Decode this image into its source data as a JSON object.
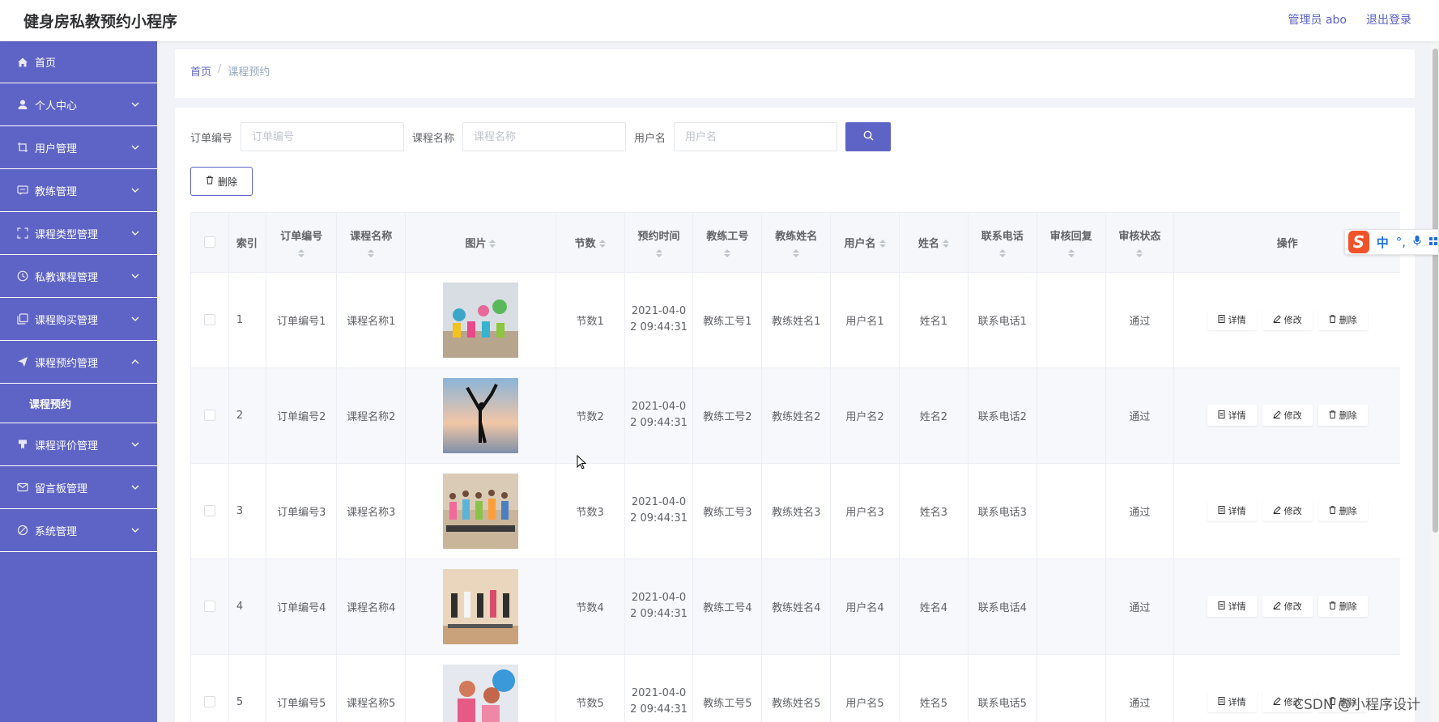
{
  "app": {
    "title": "健身房私教预约小程序"
  },
  "header": {
    "user": "管理员 abo",
    "logout": "退出登录"
  },
  "sidebar": {
    "items": [
      {
        "label": "首页",
        "icon": "home-icon"
      },
      {
        "label": "个人中心",
        "icon": "user-icon"
      },
      {
        "label": "用户管理",
        "icon": "crop-icon"
      },
      {
        "label": "教练管理",
        "icon": "chat-icon"
      },
      {
        "label": "课程类型管理",
        "icon": "fullscreen-icon"
      },
      {
        "label": "私教课程管理",
        "icon": "clock-icon"
      },
      {
        "label": "课程购买管理",
        "icon": "copy-icon"
      },
      {
        "label": "课程预约管理",
        "icon": "send-icon",
        "expanded": true,
        "sub": "课程预约"
      },
      {
        "label": "课程评价管理",
        "icon": "medal-icon"
      },
      {
        "label": "留言板管理",
        "icon": "message-icon"
      },
      {
        "label": "系统管理",
        "icon": "gear-icon"
      }
    ]
  },
  "breadcrumb": {
    "home": "首页",
    "sep": "/",
    "current": "课程预约"
  },
  "search": {
    "order_label": "订单编号",
    "order_placeholder": "订单编号",
    "course_label": "课程名称",
    "course_placeholder": "课程名称",
    "user_label": "用户名",
    "user_placeholder": "用户名"
  },
  "toolbar": {
    "delete_label": "删除"
  },
  "table": {
    "headers": {
      "index": "索引",
      "order_no": "订单编号",
      "course_name": "课程名称",
      "image": "图片",
      "sessions": "节数",
      "booking_time": "预约时间",
      "coach_id": "教练工号",
      "coach_name": "教练姓名",
      "username": "用户名",
      "name": "姓名",
      "phone": "联系电话",
      "review_reply": "审核回复",
      "review_status": "审核状态",
      "actions": "操作"
    },
    "actions": {
      "detail": "详情",
      "edit": "修改",
      "delete": "删除"
    },
    "rows": [
      {
        "index": "1",
        "order_no": "订单编号1",
        "course_name": "课程名称1",
        "sessions": "节数1",
        "time_a": "2021-04-0",
        "time_b": "2 09:44:31",
        "coach_id": "教练工号1",
        "coach_name": "教练姓名1",
        "username": "用户名1",
        "name": "姓名1",
        "phone": "联系电话1",
        "review_reply": "",
        "review_status": "通过"
      },
      {
        "index": "2",
        "order_no": "订单编号2",
        "course_name": "课程名称2",
        "sessions": "节数2",
        "time_a": "2021-04-0",
        "time_b": "2 09:44:31",
        "coach_id": "教练工号2",
        "coach_name": "教练姓名2",
        "username": "用户名2",
        "name": "姓名2",
        "phone": "联系电话2",
        "review_reply": "",
        "review_status": "通过"
      },
      {
        "index": "3",
        "order_no": "订单编号3",
        "course_name": "课程名称3",
        "sessions": "节数3",
        "time_a": "2021-04-0",
        "time_b": "2 09:44:31",
        "coach_id": "教练工号3",
        "coach_name": "教练姓名3",
        "username": "用户名3",
        "name": "姓名3",
        "phone": "联系电话3",
        "review_reply": "",
        "review_status": "通过"
      },
      {
        "index": "4",
        "order_no": "订单编号4",
        "course_name": "课程名称4",
        "sessions": "节数4",
        "time_a": "2021-04-0",
        "time_b": "2 09:44:31",
        "coach_id": "教练工号4",
        "coach_name": "教练姓名4",
        "username": "用户名4",
        "name": "姓名4",
        "phone": "联系电话4",
        "review_reply": "",
        "review_status": "通过"
      },
      {
        "index": "5",
        "order_no": "订单编号5",
        "course_name": "课程名称5",
        "sessions": "节数5",
        "time_a": "2021-04-0",
        "time_b": "2 09:44:31",
        "coach_id": "教练工号5",
        "coach_name": "教练姓名5",
        "username": "用户名5",
        "name": "姓名5",
        "phone": "联系电话5",
        "review_reply": "",
        "review_status": "通过"
      }
    ]
  },
  "ime": {
    "logo": "S",
    "mode": "中",
    "punct": "°,",
    "mic": "mic-icon",
    "more": "grid-icon"
  },
  "watermark": "CSDN @小程序设计",
  "colors": {
    "accent": "#5e64c6",
    "header_text": "#5a61c1",
    "stripe": "#f7f8fc"
  }
}
